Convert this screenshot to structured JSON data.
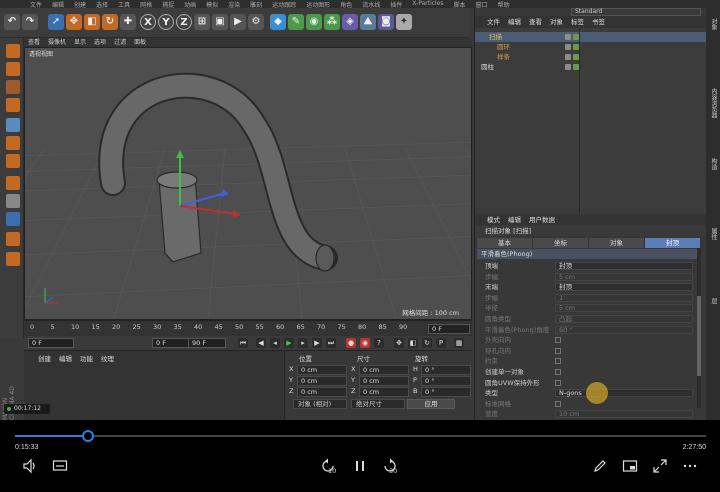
{
  "app": {
    "menu": [
      "文件",
      "编辑",
      "创建",
      "选择",
      "工具",
      "网格",
      "捕捉",
      "动画",
      "模拟",
      "渲染",
      "雕刻",
      "运动跟踪",
      "运动图形",
      "角色",
      "流水线",
      "插件",
      "X-Particles",
      "脚本",
      "窗口",
      "帮助"
    ],
    "layout_value": "Standard"
  },
  "toolbar": {
    "axis_x": "X",
    "axis_y": "Y",
    "axis_z": "Z"
  },
  "viewport": {
    "menu": [
      "查看",
      "摄像机",
      "显示",
      "选项",
      "过滤",
      "面板"
    ],
    "label": "透视视图",
    "grid_spacing": "网格间距 : 100 cm"
  },
  "timeline": {
    "ticks": [
      "0",
      "5",
      "10",
      "15",
      "20",
      "25",
      "30",
      "35",
      "40",
      "45",
      "50",
      "55",
      "60",
      "65",
      "70",
      "75",
      "80",
      "85",
      "90"
    ],
    "current_frame": "0 F",
    "start": "0 F",
    "start2": "0 F",
    "end": "90 F",
    "end2": "90 F"
  },
  "material": {
    "menu": [
      "创建",
      "编辑",
      "功能",
      "纹理"
    ]
  },
  "coordinates": {
    "headers": [
      "位置",
      "尺寸",
      "旋转"
    ],
    "rows": [
      {
        "axis": "X",
        "pos": "0 cm",
        "size_axis": "X",
        "size": "0 cm",
        "rot_axis": "H",
        "rot": "0 °"
      },
      {
        "axis": "Y",
        "pos": "0 cm",
        "size_axis": "Y",
        "size": "0 cm",
        "rot_axis": "P",
        "rot": "0 °"
      },
      {
        "axis": "Z",
        "pos": "0 cm",
        "size_axis": "Z",
        "size": "0 cm",
        "rot_axis": "B",
        "rot": "0 °"
      }
    ],
    "mode1": "对象 (相对)",
    "mode2": "绝对尺寸",
    "apply": "应用"
  },
  "objects": {
    "menu": [
      "文件",
      "编辑",
      "查看",
      "对象",
      "标签",
      "书签"
    ],
    "items": [
      {
        "name": "扫描",
        "color": "#e0c060"
      },
      {
        "name": "圆环",
        "color": "#d89a4a"
      },
      {
        "name": "样条",
        "color": "#d89a4a"
      },
      {
        "name": "圆柱",
        "color": "#dddddd"
      }
    ]
  },
  "attributes": {
    "menu": [
      "模式",
      "编辑",
      "用户数据"
    ],
    "title": "扫描对象 [扫描]",
    "tabs": [
      "基本",
      "坐标",
      "对象",
      "封顶"
    ],
    "active_tab": "封顶",
    "section": "平滑着色(Phong)",
    "rows": [
      {
        "label": "顶端",
        "value": "封顶",
        "dim": false
      },
      {
        "label": "步幅",
        "value": "5 cm",
        "dim": true
      },
      {
        "label": "末端",
        "value": "封顶",
        "dim": false
      },
      {
        "label": "步幅",
        "value": "1",
        "dim": true
      },
      {
        "label": "半径",
        "value": "5 cm",
        "dim": true
      },
      {
        "label": "圆角类型",
        "value": "凸起",
        "dim": true
      },
      {
        "label": "平滑着色(Phong)角度",
        "value": "60 °",
        "dim": true
      },
      {
        "label": "外壳向内",
        "value": "",
        "dim": true
      },
      {
        "label": "穿孔向内",
        "value": "",
        "dim": true
      },
      {
        "label": "约束",
        "value": "",
        "dim": true
      },
      {
        "label": "创建单一对象",
        "value": "",
        "dim": false
      },
      {
        "label": "圆角UVW保持外形",
        "value": "",
        "dim": false
      },
      {
        "label": "类型",
        "value": "N-gons",
        "dim": false
      },
      {
        "label": "标准网格",
        "value": "",
        "dim": true
      },
      {
        "label": "宽度",
        "value": "10 cm",
        "dim": true
      }
    ]
  },
  "sidebar": {
    "tabs": [
      "对象",
      "内容浏览器",
      "构造",
      "属性",
      "层"
    ]
  },
  "recording": {
    "badge": "00:17:12",
    "brand": "MAXON CINEMA 4D"
  },
  "player": {
    "current": "0:15:33",
    "total": "2:27:50",
    "progress": 0.105,
    "skip_back": "10",
    "skip_fwd": "30"
  }
}
